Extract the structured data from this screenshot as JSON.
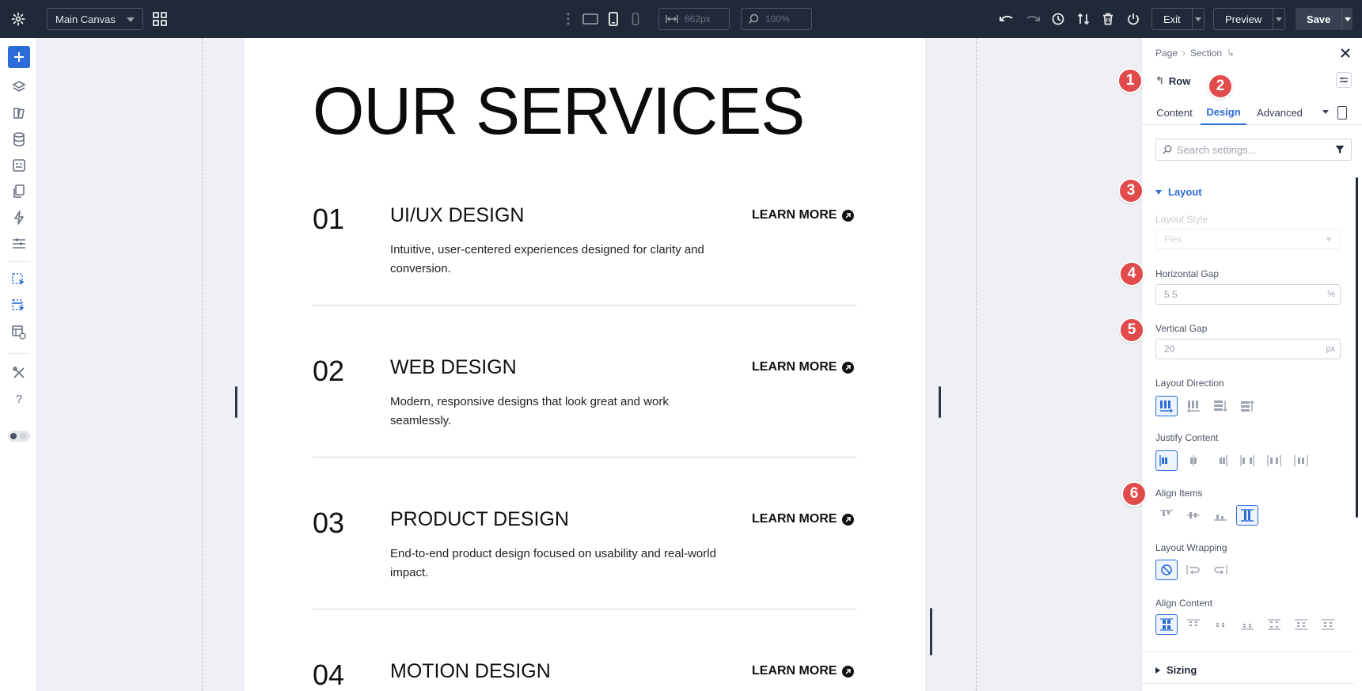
{
  "toolbar": {
    "canvas_select": "Main Canvas",
    "width_value": "862px",
    "zoom_value": "100%",
    "exit_label": "Exit",
    "preview_label": "Preview",
    "save_label": "Save"
  },
  "page": {
    "title": "OUR SERVICES",
    "services": [
      {
        "num": "01",
        "name": "UI/UX DESIGN",
        "desc": "Intuitive, user-centered experiences designed for clarity and conversion.",
        "cta": "LEARN MORE"
      },
      {
        "num": "02",
        "name": "WEB DESIGN",
        "desc": "Modern, responsive designs that look great and work seamlessly.",
        "cta": "LEARN MORE"
      },
      {
        "num": "03",
        "name": "PRODUCT DESIGN",
        "desc": "End-to-end product design focused on usability and real-world impact.",
        "cta": "LEARN MORE"
      },
      {
        "num": "04",
        "name": "MOTION DESIGN",
        "desc": "",
        "cta": "LEARN MORE"
      }
    ]
  },
  "panel": {
    "breadcrumb": [
      "Page",
      "Section"
    ],
    "element_label": "Row",
    "tabs": [
      "Content",
      "Design",
      "Advanced"
    ],
    "search_placeholder": "Search settings...",
    "layout_section": "Layout",
    "layout_style_label": "Layout Style",
    "layout_style_value": "Flex",
    "horizontal_gap_label": "Horizontal Gap",
    "horizontal_gap_value": "5.5",
    "horizontal_gap_unit": "%",
    "vertical_gap_label": "Vertical Gap",
    "vertical_gap_value": "20",
    "vertical_gap_unit": "px",
    "layout_direction_label": "Layout Direction",
    "justify_content_label": "Justify Content",
    "align_items_label": "Align Items",
    "layout_wrapping_label": "Layout Wrapping",
    "align_content_label": "Align Content",
    "sizing_section": "Sizing"
  },
  "badges": [
    "1",
    "2",
    "3",
    "4",
    "5",
    "6"
  ],
  "colors": {
    "accent": "#2b6cd8",
    "topbar": "#1f2937",
    "badge": "#e14b4b"
  }
}
